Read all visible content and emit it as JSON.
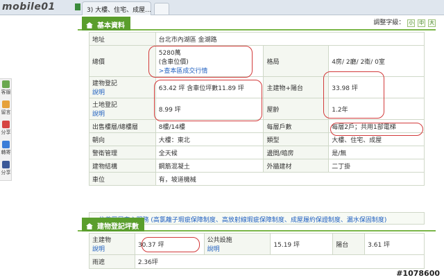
{
  "browser": {
    "logo": "mobile01",
    "tab_title": "3) 大樓、住宅、成屋..."
  },
  "sidebar": {
    "items": [
      {
        "label": "客服",
        "color": "#6aa84f"
      },
      {
        "label": "留言",
        "color": "#e6a23c"
      },
      {
        "label": "分享",
        "color": "#d64541"
      },
      {
        "label": "轉寄",
        "color": "#3b7dd8"
      },
      {
        "label": "分享",
        "color": "#3b5998"
      }
    ]
  },
  "basic": {
    "section_title": "基本資料",
    "font_adjust_label": "調整字級：",
    "font_sizes": [
      "小",
      "中",
      "大"
    ],
    "address_label": "地址",
    "address_value": "台北市內湖區 金湖路",
    "price_label": "總價",
    "price_value": "5280萬",
    "price_note": "(含車位價)",
    "price_link": ">查本區成交行情",
    "layout_label": "格局",
    "layout_value": "4房/ 2廳/ 2衛/ 0室",
    "building_reg_label": "建物登記",
    "explain_label": "說明",
    "building_reg_value": "63.42 坪 含車位坪數11.89 坪",
    "main_balcony_label": "主建物+陽台",
    "main_balcony_value": "33.98 坪",
    "land_reg_label": "土地登記",
    "land_reg_value": "8.99 坪",
    "age_label": "屋齡",
    "age_value": "1.2年",
    "floor_label": "出售樓層/總樓層",
    "floor_value": "8樓/14樓",
    "units_label": "每層戶數",
    "units_value": "每層2戶；共用1部電梯",
    "facing_label": "朝向",
    "facing_value": "大樓：東北",
    "type_label": "類型",
    "type_value": "大樓、住宅、成屋",
    "mgmt_label": "警衛管理",
    "mgmt_value": "全天候",
    "dark_label": "邊間/暗房",
    "dark_value": "是/無",
    "structure_label": "建物結構",
    "structure_value": "鋼筋混凝土",
    "wall_label": "外牆建材",
    "wall_value": "二丁掛",
    "parking_label": "車位",
    "parking_value": "有，坡道機械",
    "service_text": ">信義買屋安心服務 (高氯離子瑕疵保障制度、高放射線瑕疵保障制度、成屋履約保證制度、漏水保固制度)"
  },
  "reg": {
    "section_title": "建物登記坪數",
    "main_label": "主建物",
    "main_value": "30.37 坪",
    "public_label": "公共設施",
    "public_value": "15.19 坪",
    "balcony_label": "陽台",
    "balcony_value": "3.61 坪",
    "eaves_label": "雨遮",
    "eaves_value": "2.36坪"
  },
  "watermark": "#1078600"
}
